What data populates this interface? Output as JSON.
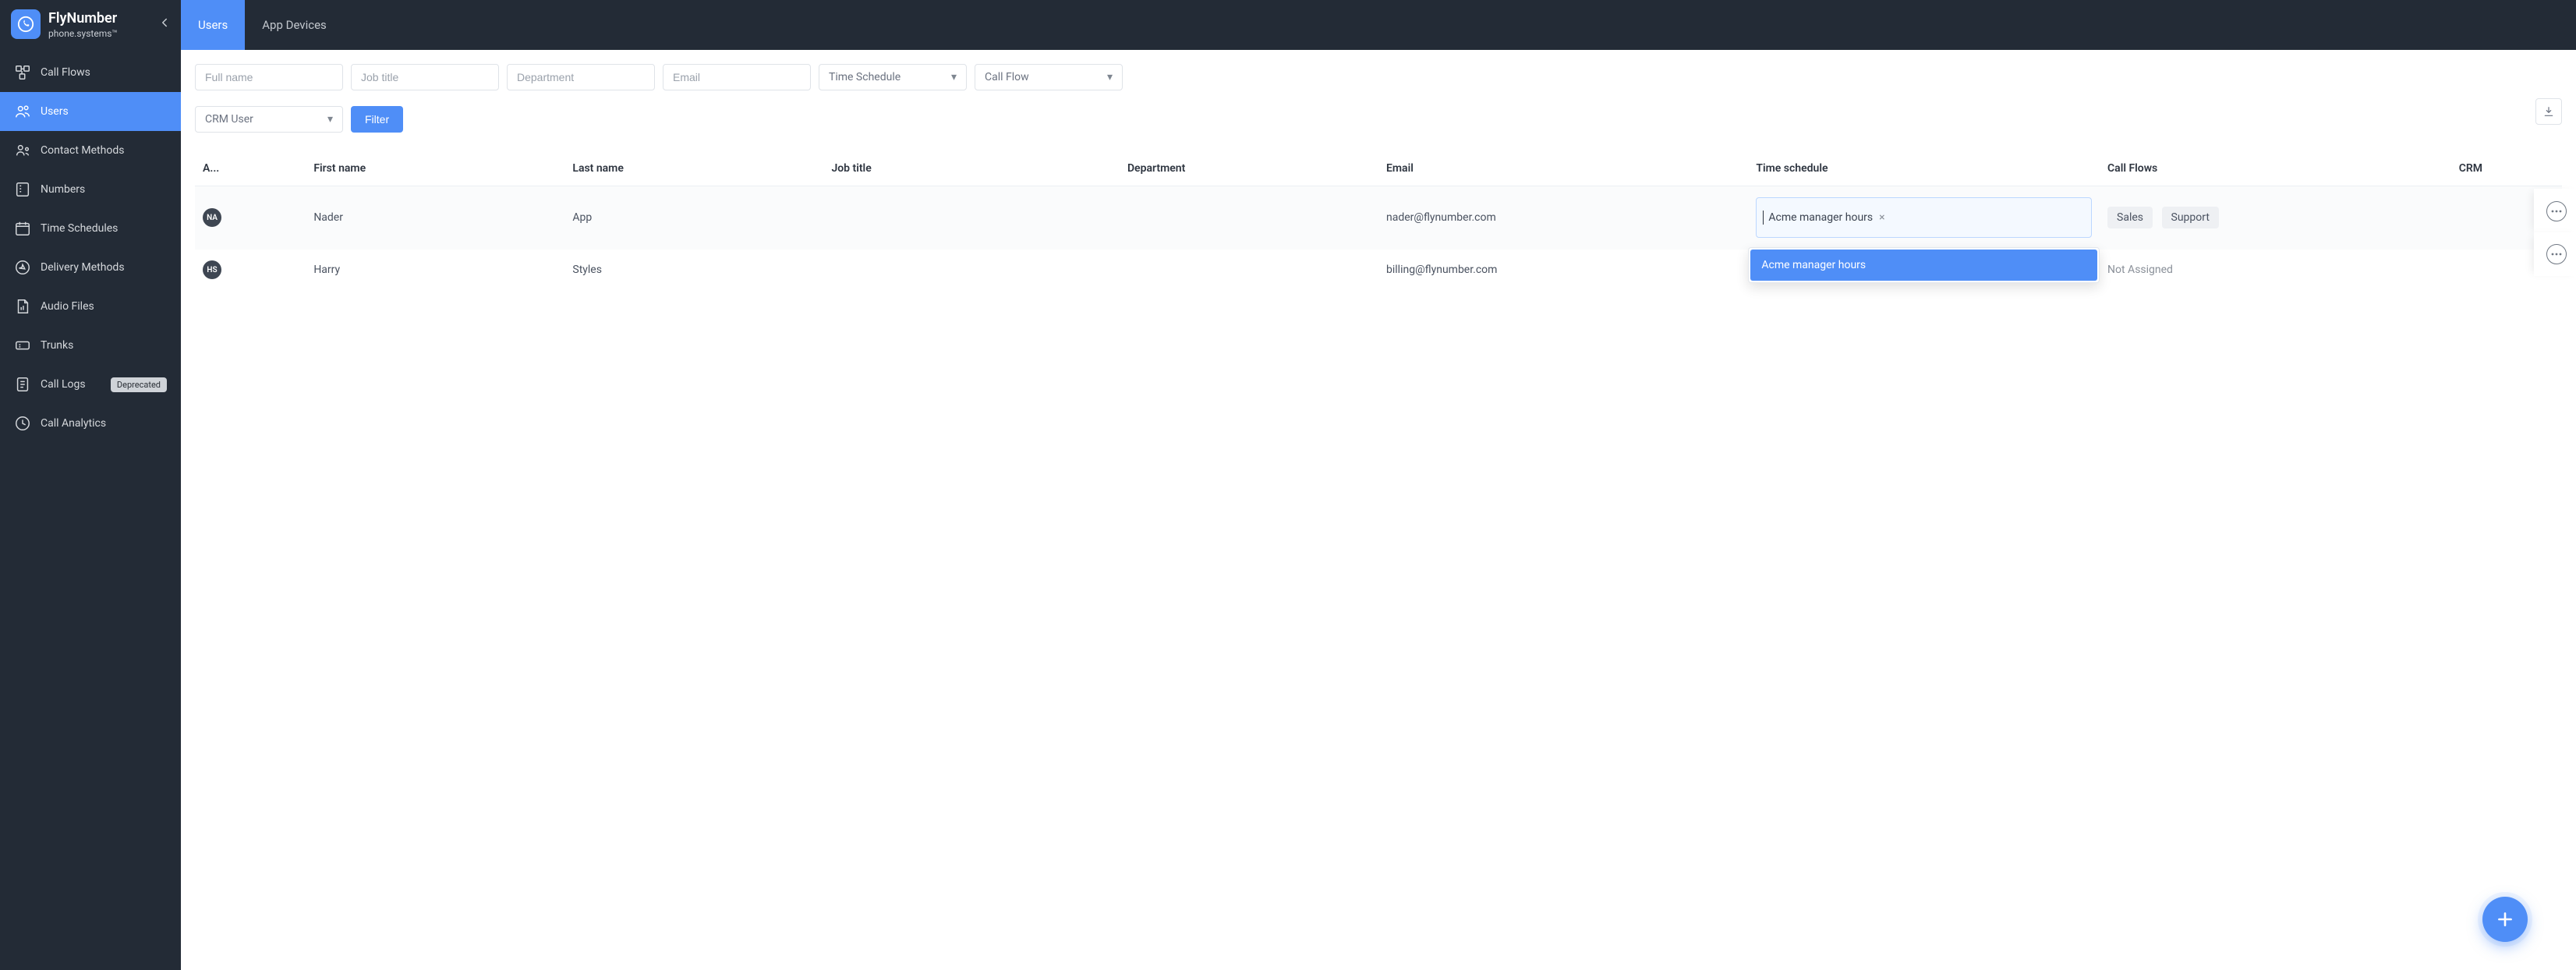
{
  "brand": {
    "title": "FlyNumber",
    "subtitle": "phone.systems™"
  },
  "sidebar": {
    "items": [
      {
        "label": "Call Flows",
        "icon": "flow-icon"
      },
      {
        "label": "Users",
        "icon": "users-icon",
        "active": true
      },
      {
        "label": "Contact Methods",
        "icon": "contact-icon"
      },
      {
        "label": "Numbers",
        "icon": "numbers-icon"
      },
      {
        "label": "Time Schedules",
        "icon": "calendar-icon"
      },
      {
        "label": "Delivery Methods",
        "icon": "delivery-icon"
      },
      {
        "label": "Audio Files",
        "icon": "audio-icon"
      },
      {
        "label": "Trunks",
        "icon": "trunks-icon"
      },
      {
        "label": "Call Logs",
        "icon": "logs-icon",
        "badge": "Deprecated"
      },
      {
        "label": "Call Analytics",
        "icon": "analytics-icon"
      }
    ]
  },
  "tabs": [
    {
      "label": "Users",
      "active": true
    },
    {
      "label": "App Devices"
    }
  ],
  "filters": {
    "full_name_placeholder": "Full name",
    "job_title_placeholder": "Job title",
    "department_placeholder": "Department",
    "email_placeholder": "Email",
    "time_schedule_label": "Time Schedule",
    "call_flow_label": "Call Flow",
    "crm_user_label": "CRM User",
    "filter_button": "Filter"
  },
  "table": {
    "columns": [
      "A...",
      "First name",
      "Last name",
      "Job title",
      "Department",
      "Email",
      "Time schedule",
      "Call Flows",
      "CRM"
    ],
    "rows": [
      {
        "avatar": "NA",
        "first_name": "Nader",
        "last_name": "App",
        "job_title": "",
        "department": "",
        "email": "nader@flynumber.com",
        "schedule_tag": "Acme manager hours",
        "dropdown_option": "Acme manager hours",
        "call_flows": [
          "Sales",
          "Support"
        ]
      },
      {
        "avatar": "HS",
        "first_name": "Harry",
        "last_name": "Styles",
        "job_title": "",
        "department": "",
        "email": "billing@flynumber.com",
        "schedule_tag": "",
        "call_flows_text": "Not Assigned"
      }
    ]
  },
  "colors": {
    "accent": "#4f8ef7",
    "dark": "#232b36"
  }
}
